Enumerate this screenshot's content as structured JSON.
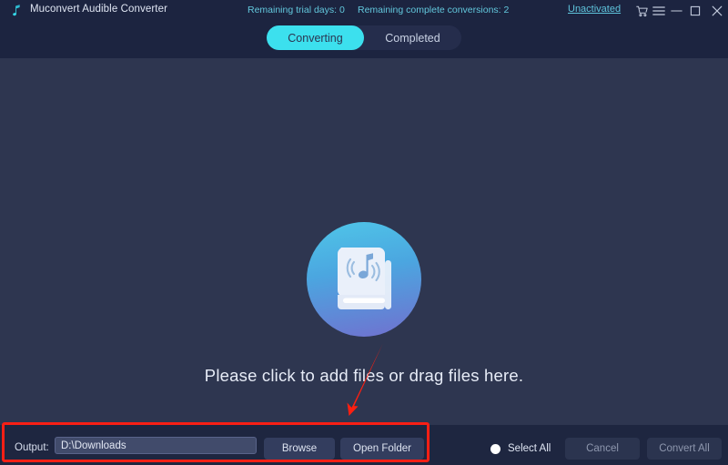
{
  "window": {
    "app_title": "Muconvert Audible Converter",
    "logo_icon": "music-note-icon",
    "trial_days": "Remaining trial days: 0",
    "complete_conversions": "Remaining complete conversions: 2",
    "activation_link": "Unactivated",
    "controls": [
      {
        "name": "cart-icon",
        "label": "Cart"
      },
      {
        "name": "menu-icon",
        "label": "Menu"
      },
      {
        "name": "minimize-icon",
        "label": "Minimize"
      },
      {
        "name": "maximize-icon",
        "label": "Maximize"
      },
      {
        "name": "close-icon",
        "label": "Close"
      }
    ],
    "accent_color": "#3ce0ee",
    "link_color": "#5fc4dc",
    "header_bg": "#1c2440",
    "body_bg": "#2e3650",
    "annotation_color": "#f81f15"
  },
  "tabs": [
    {
      "label": "Converting",
      "active": true
    },
    {
      "label": "Completed",
      "active": false
    }
  ],
  "main": {
    "drop_icon": "audiobook-icon",
    "drop_text": "Please click to add files or drag files here.",
    "annotation_arrow": "red-down-arrow"
  },
  "footer": {
    "output_label": "Output:",
    "output_value": "D:\\Downloads",
    "output_placeholder": "D:\\Downloads",
    "browse_label": "Browse",
    "open_folder_label": "Open Folder",
    "select_all_label": "Select All",
    "cancel_label": "Cancel",
    "convert_all_label": "Convert All"
  }
}
